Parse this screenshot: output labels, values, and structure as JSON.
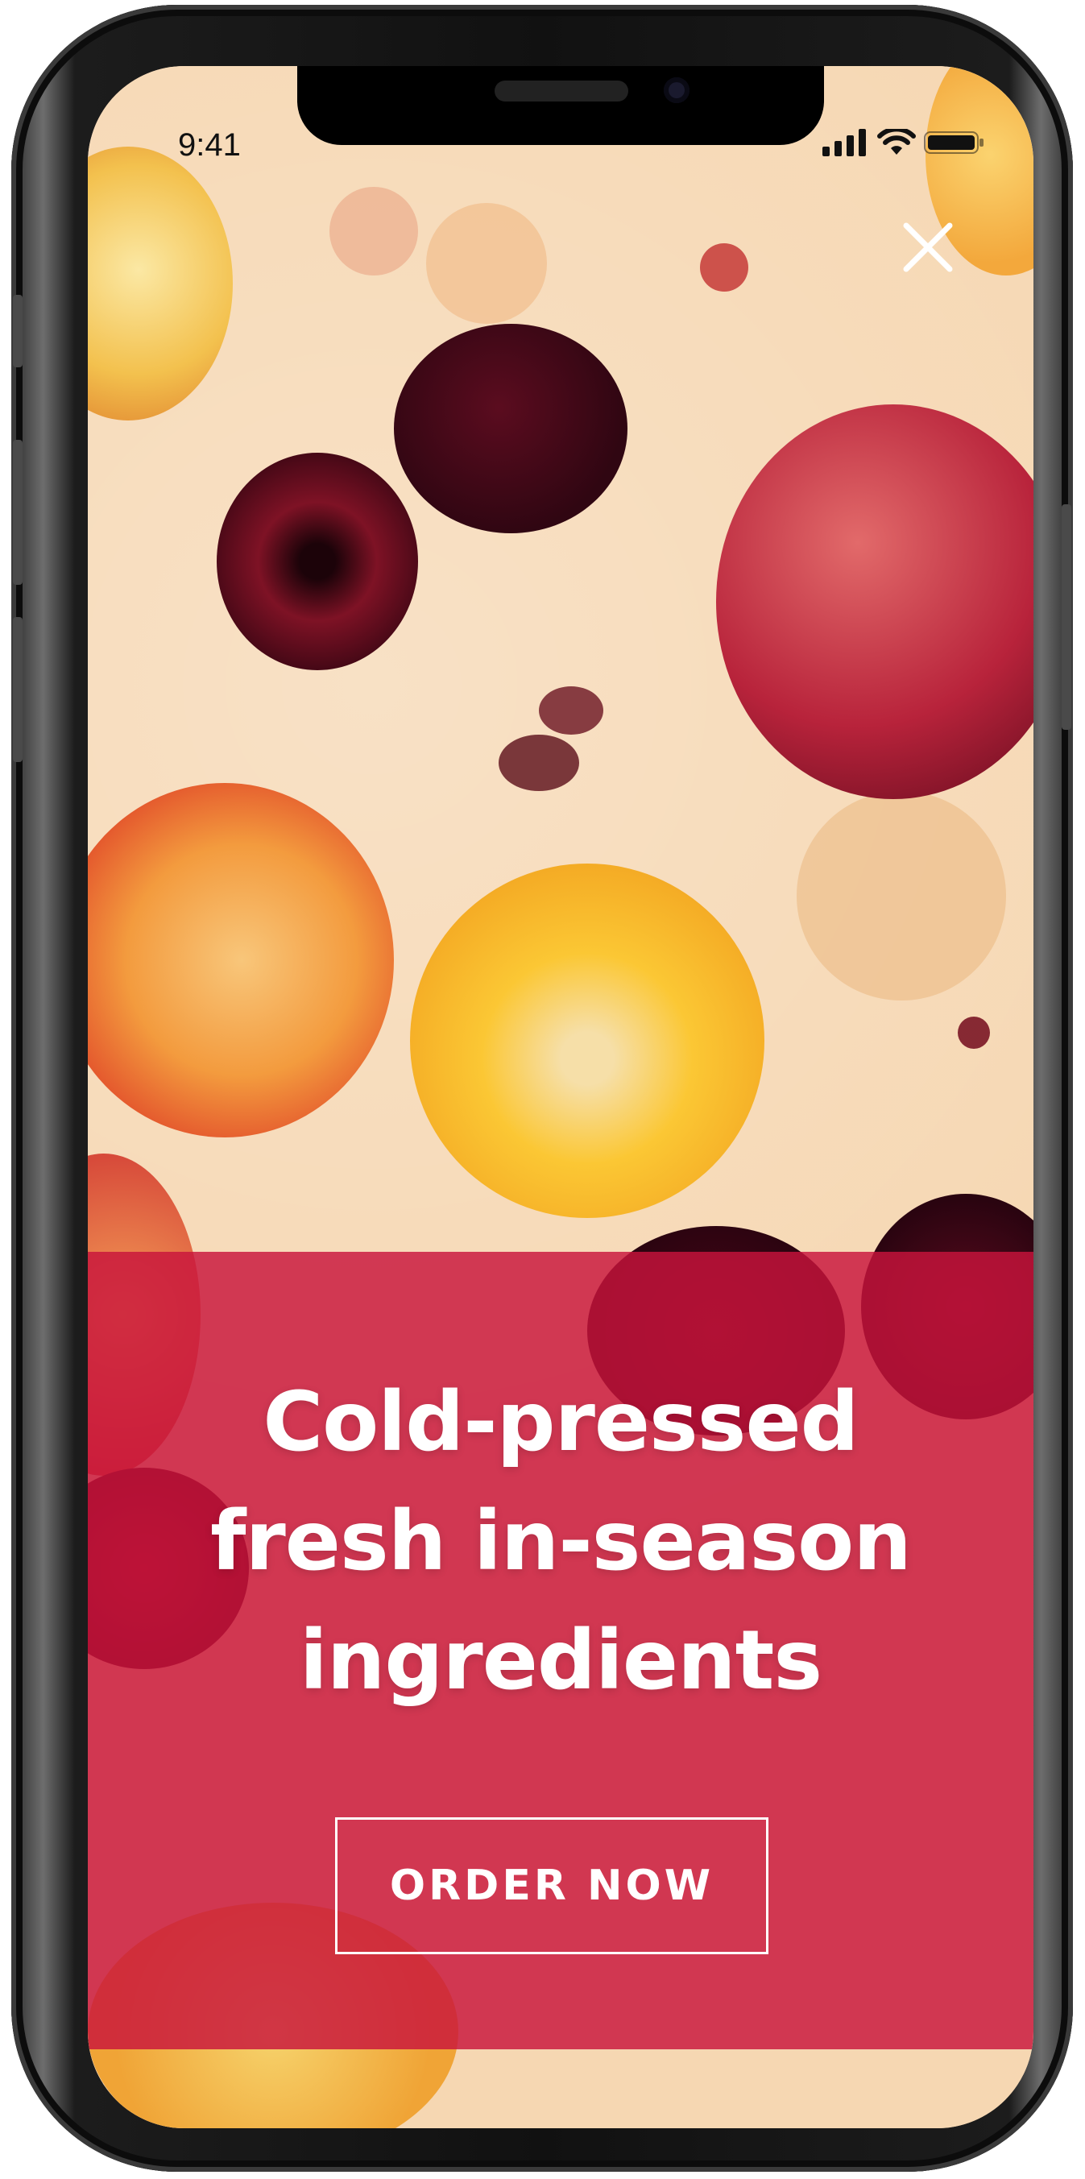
{
  "status_bar": {
    "time": "9:41",
    "icons": [
      "signal-icon",
      "wifi-icon",
      "battery-icon"
    ]
  },
  "promo": {
    "headline_lines": [
      "Cold-pressed",
      "fresh in-season",
      "ingredients"
    ],
    "cta_label": "ORDER NOW",
    "close_icon": "close-icon"
  },
  "colors": {
    "accent": "#c8143c",
    "background": "#f6d7b2",
    "text_on_accent": "#ffffff"
  }
}
